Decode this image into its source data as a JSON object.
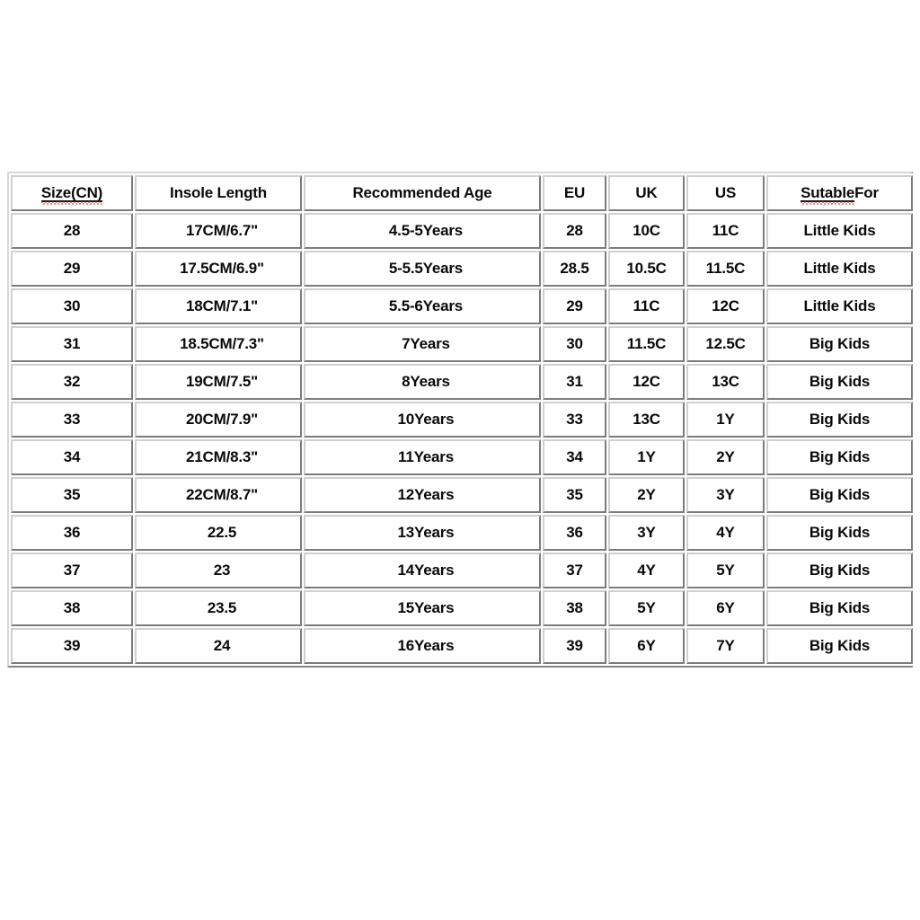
{
  "table": {
    "name": "childrens-shoe-size-chart",
    "columns": [
      {
        "key": "cn",
        "label": "Size(CN)",
        "misspelled": true
      },
      {
        "key": "insole",
        "label": "Insole Length",
        "misspelled": false
      },
      {
        "key": "age",
        "label": "Recommended Age",
        "misspelled": false
      },
      {
        "key": "eu",
        "label": "EU",
        "misspelled": false
      },
      {
        "key": "uk",
        "label": "UK",
        "misspelled": false
      },
      {
        "key": "us",
        "label": "US",
        "misspelled": false
      },
      {
        "key": "suit",
        "label": "Sutable For",
        "misspelled": true,
        "underlined_word": "Sutable",
        "trailing_word": " For"
      }
    ],
    "rows": [
      {
        "cn": "28",
        "insole": "17CM/6.7\"",
        "age": "4.5-5Years",
        "eu": "28",
        "uk": "10C",
        "us": "11C",
        "suit": "Little Kids"
      },
      {
        "cn": "29",
        "insole": "17.5CM/6.9\"",
        "age": "5-5.5Years",
        "eu": "28.5",
        "uk": "10.5C",
        "us": "11.5C",
        "suit": "Little Kids"
      },
      {
        "cn": "30",
        "insole": "18CM/7.1\"",
        "age": "5.5-6Years",
        "eu": "29",
        "uk": "11C",
        "us": "12C",
        "suit": "Little Kids"
      },
      {
        "cn": "31",
        "insole": "18.5CM/7.3\"",
        "age": "7Years",
        "eu": "30",
        "uk": "11.5C",
        "us": "12.5C",
        "suit": "Big Kids"
      },
      {
        "cn": "32",
        "insole": "19CM/7.5\"",
        "age": "8Years",
        "eu": "31",
        "uk": "12C",
        "us": "13C",
        "suit": "Big Kids"
      },
      {
        "cn": "33",
        "insole": "20CM/7.9\"",
        "age": "10Years",
        "eu": "33",
        "uk": "13C",
        "us": "1Y",
        "suit": "Big Kids"
      },
      {
        "cn": "34",
        "insole": "21CM/8.3\"",
        "age": "11Years",
        "eu": "34",
        "uk": "1Y",
        "us": "2Y",
        "suit": "Big Kids"
      },
      {
        "cn": "35",
        "insole": "22CM/8.7\"",
        "age": "12Years",
        "eu": "35",
        "uk": "2Y",
        "us": "3Y",
        "suit": "Big Kids"
      },
      {
        "cn": "36",
        "insole": "22.5",
        "age": "13Years",
        "eu": "36",
        "uk": "3Y",
        "us": "4Y",
        "suit": "Big Kids"
      },
      {
        "cn": "37",
        "insole": "23",
        "age": "14Years",
        "eu": "37",
        "uk": "4Y",
        "us": "5Y",
        "suit": "Big Kids"
      },
      {
        "cn": "38",
        "insole": "23.5",
        "age": "15Years",
        "eu": "38",
        "uk": "5Y",
        "us": "6Y",
        "suit": "Big Kids"
      },
      {
        "cn": "39",
        "insole": "24",
        "age": "16Years",
        "eu": "39",
        "uk": "6Y",
        "us": "7Y",
        "suit": "Big Kids"
      }
    ]
  },
  "colors": {
    "page_background": "#ffffff",
    "cell_background": "#ffffff",
    "cell_border": "#d0d0d0",
    "text": "#0a0a0a",
    "spellcheck_squiggle": "#cc2222"
  }
}
